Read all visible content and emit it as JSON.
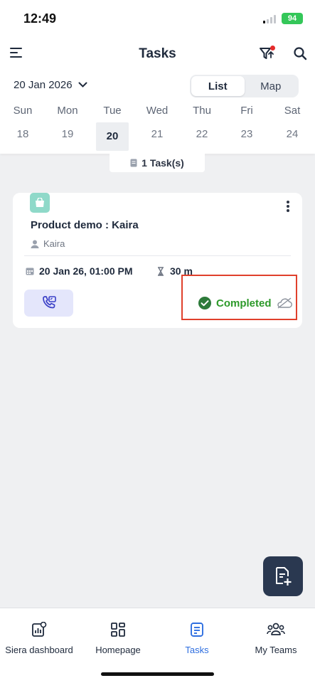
{
  "status_bar": {
    "time": "12:49",
    "battery": "94"
  },
  "header": {
    "title": "Tasks",
    "menu_icon": "hamburger-menu-icon",
    "filter_icon": "filter-icon",
    "search_icon": "search-icon"
  },
  "date_selector": {
    "date": "20 Jan 2026",
    "chevron_icon": "chevron-down-icon"
  },
  "view_toggle": {
    "options": [
      "List",
      "Map"
    ],
    "selected": "List"
  },
  "week": {
    "days": [
      {
        "name": "Sun",
        "num": "18"
      },
      {
        "name": "Mon",
        "num": "19"
      },
      {
        "name": "Tue",
        "num": "20"
      },
      {
        "name": "Wed",
        "num": "21"
      },
      {
        "name": "Thu",
        "num": "22"
      },
      {
        "name": "Fri",
        "num": "23"
      },
      {
        "name": "Sat",
        "num": "24"
      }
    ],
    "selected": "20"
  },
  "task_count": "1 Task(s)",
  "task_card": {
    "title": "Product demo : Kaira",
    "assignee": "Kaira",
    "datetime": "20 Jan 26, 01:00 PM",
    "duration": "30 m",
    "status": "Completed",
    "status_color": "#2d9a2a",
    "icons": [
      "task-type-icon",
      "more-options-icon",
      "person-icon",
      "calendar-icon",
      "hourglass-icon",
      "call-icon",
      "completed-check-icon",
      "cloud-off-icon"
    ]
  },
  "fab": {
    "icon": "add-task-icon"
  },
  "bottom_nav": {
    "items": [
      {
        "label": "Siera dashboard",
        "icon": "dashboard-icon"
      },
      {
        "label": "Homepage",
        "icon": "grid-icon"
      },
      {
        "label": "Tasks",
        "icon": "tasks-icon"
      },
      {
        "label": "My Teams",
        "icon": "team-icon"
      }
    ],
    "active": "Tasks"
  },
  "colors": {
    "accent": "#2f6fe0",
    "dark": "#2a3850",
    "highlight_border": "#e0402c"
  }
}
